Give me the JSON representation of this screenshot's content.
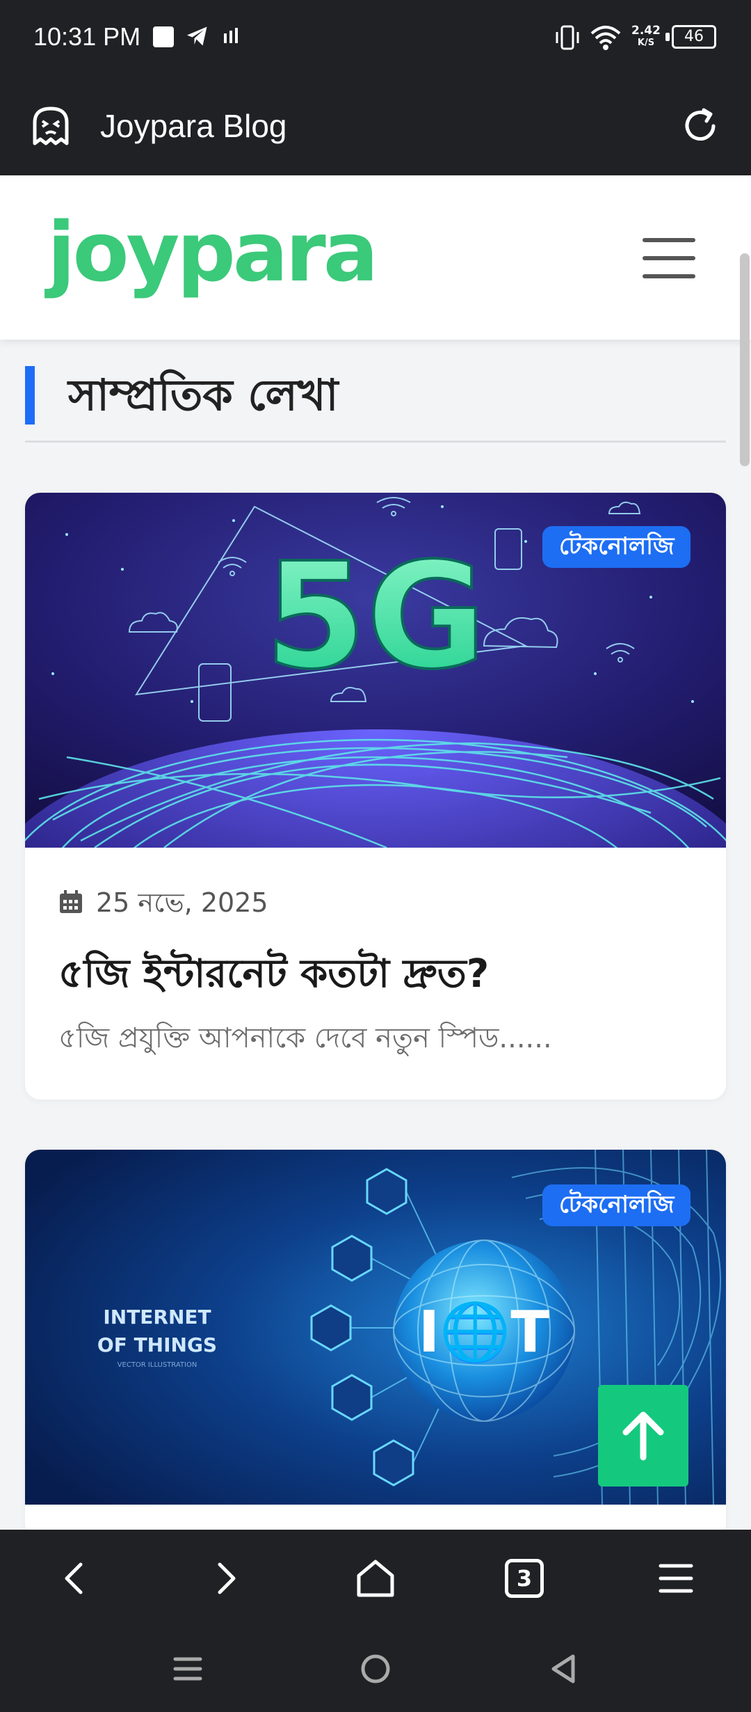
{
  "status_bar": {
    "time": "10:31 PM",
    "net_speed_value": "2.42",
    "net_speed_unit": "K/S",
    "battery": "46"
  },
  "app_bar": {
    "title": "Joypara Blog"
  },
  "site": {
    "logo": "joypara"
  },
  "section": {
    "title": "সাম্প্রতিক লেখা"
  },
  "posts": [
    {
      "category": "টেকনোলজি",
      "date": "25 নভে, 2025",
      "title": "৫জি ইন্টারনেট কতটা দ্রুত?",
      "excerpt": "৫জি প্রযুক্তি আপনাকে দেবে নতুন স্পিড......",
      "image_text": "5G"
    },
    {
      "category": "টেকনোলজি",
      "image_text_line1": "INTERNET",
      "image_text_line2": "OF THINGS",
      "image_text_small": "VECTOR ILLUSTRATION",
      "image_badge": "I🌐T"
    }
  ],
  "browser_bar": {
    "tab_count": "3"
  },
  "colors": {
    "accent_blue": "#1d6ef3",
    "logo_green": "#3bc97a",
    "to_top_green": "#14c97e",
    "dark_bar": "#202124"
  }
}
